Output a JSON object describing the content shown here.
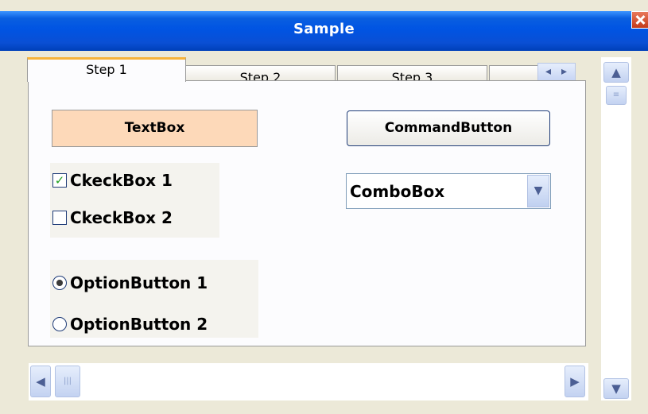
{
  "window": {
    "title": "Sample"
  },
  "tabs": [
    "Step 1",
    "Step 2",
    "Step 3"
  ],
  "controls": {
    "textbox_label": "TextBox",
    "command_button_label": "CommandButton",
    "checkbox1_label": "CkeckBox 1",
    "checkbox2_label": "CkeckBox 2",
    "option1_label": "OptionButton 1",
    "option2_label": "OptionButton 2",
    "combo_value": "ComboBox"
  },
  "state": {
    "checkbox1_checked": true,
    "checkbox2_checked": false,
    "option_selected": 1
  }
}
